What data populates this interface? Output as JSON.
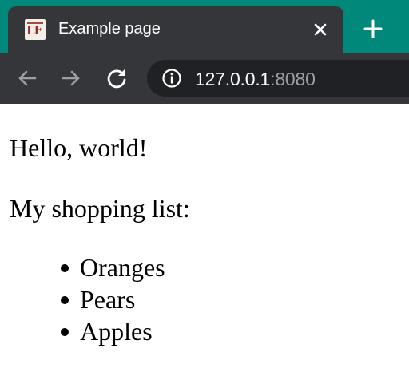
{
  "tab": {
    "title": "Example page",
    "favicon": "document-favicon-icon",
    "close_icon": "close-icon"
  },
  "toolbar": {
    "back_icon": "back-arrow-icon",
    "forward_icon": "forward-arrow-icon",
    "reload_icon": "reload-icon",
    "new_tab_icon": "plus-icon",
    "site_info_icon": "info-icon"
  },
  "address_bar": {
    "host": "127.0.0.1",
    "port": ":8080"
  },
  "page": {
    "greeting": "Hello, world!",
    "list_heading": "My shopping list:",
    "items": [
      "Oranges",
      "Pears",
      "Apples"
    ]
  },
  "colors": {
    "frame_accent": "#00897b",
    "tab_background": "#35363a",
    "omnibox_background": "#202124",
    "url_muted": "#9aa0a6",
    "icon_inactive": "#9aa0a6",
    "icon_active": "#ffffff"
  }
}
